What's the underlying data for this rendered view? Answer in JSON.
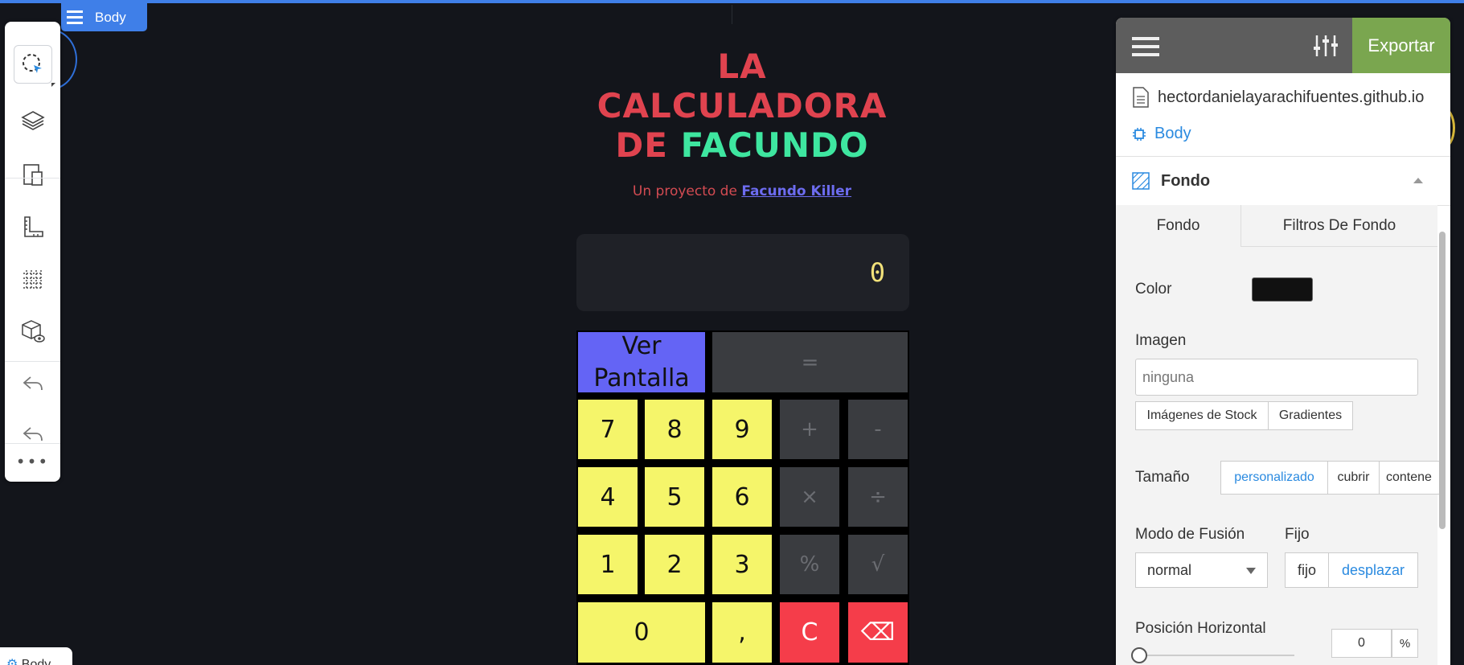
{
  "editor": {
    "selected_tag": "Body",
    "bottom_tag": "Body",
    "toolbar_more": "•••"
  },
  "calculator": {
    "title_line1": "LA",
    "title_line2": "CALCULADORA",
    "title_line3_a": "DE",
    "title_line3_b": "FACUNDO",
    "subtitle_prefix": "Un proyecto de",
    "subtitle_link": "Facundo Killer",
    "display_value": "0",
    "keys": {
      "ver_pantalla_1": "Ver",
      "ver_pantalla_2": "Pantalla",
      "equals": "=",
      "k7": "7",
      "k8": "8",
      "k9": "9",
      "plus": "+",
      "minus": "-",
      "k4": "4",
      "k5": "5",
      "k6": "6",
      "times": "×",
      "divide": "÷",
      "k1": "1",
      "k2": "2",
      "k3": "3",
      "percent": "%",
      "sqrt": "√",
      "k0": "0",
      "comma": ",",
      "clear": "C",
      "backspace": "⌫"
    },
    "colors": {
      "title_red": "#e0434f",
      "title_green": "#3ee6a0",
      "key_yellow": "#f5f56a",
      "key_blue": "#6464f5",
      "key_red": "#f53d4a",
      "key_gray": "#3a3c40"
    }
  },
  "panel": {
    "export_label": "Exportar",
    "domain": "hectordanielayarachifuentes.github.io",
    "breadcrumb": "Body",
    "section_title": "Fondo",
    "tabs": [
      "Fondo",
      "Filtros De Fondo"
    ],
    "color_label": "Color",
    "color_value": "#111111",
    "image_label": "Imagen",
    "image_value": "ninguna",
    "stock_button": "Imágenes de Stock",
    "gradients_button": "Gradientes",
    "size_label": "Tamaño",
    "size_options": [
      "personalizado",
      "cubrir",
      "contene"
    ],
    "blend_label": "Modo de Fusión",
    "blend_value": "normal",
    "fixed_label": "Fijo",
    "fixed_options": [
      "fijo",
      "desplazar"
    ],
    "hpos_label": "Posición Horizontal",
    "hpos_value": "0",
    "hpos_unit": "%",
    "accent_color": "#7aa64f"
  }
}
